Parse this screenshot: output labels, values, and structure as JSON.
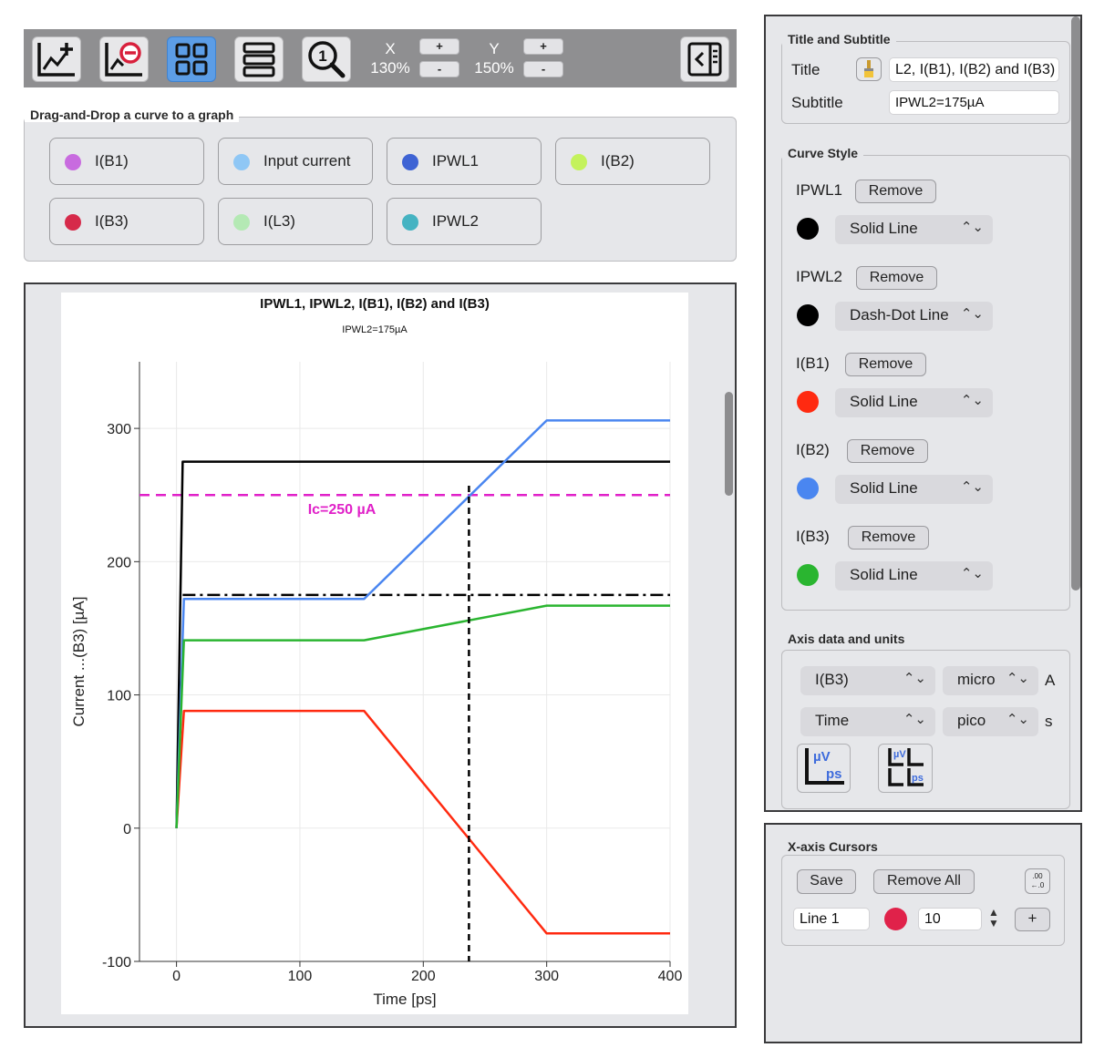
{
  "toolbar": {
    "icons": [
      "add-graph-icon",
      "remove-graph-icon",
      "grid-layout-icon",
      "list-layout-icon",
      "zoom-reset-icon",
      "sidebar-toggle-icon"
    ],
    "x_label": "X",
    "x_zoom": "130%",
    "y_label": "Y",
    "y_zoom": "150%",
    "plus": "+",
    "minus": "-"
  },
  "curves_group": {
    "title": "Drag-and-Drop a curve to a graph",
    "curves": [
      {
        "label": "I(B1)",
        "color": "#c86bdf"
      },
      {
        "label": "Input current",
        "color": "#8fc7f5"
      },
      {
        "label": "IPWL1",
        "color": "#3e63d4"
      },
      {
        "label": "I(B2)",
        "color": "#c4f25c"
      },
      {
        "label": "I(B3)",
        "color": "#d62a4a"
      },
      {
        "label": "I(L3)",
        "color": "#b4e9b4"
      },
      {
        "label": "IPWL2",
        "color": "#45b3c2"
      }
    ]
  },
  "chart_data": {
    "type": "line",
    "title": "IPWL1, IPWL2, I(B1), I(B2) and I(B3)",
    "subtitle": "IPWL2=175µA",
    "xlabel": "Time [ps]",
    "ylabel": "Current ...(B3) [µA]",
    "xlim": [
      -30,
      400
    ],
    "ylim": [
      -100,
      350
    ],
    "xticks": [
      0,
      100,
      200,
      300,
      400
    ],
    "yticks": [
      -100,
      0,
      100,
      200,
      300
    ],
    "grid": true,
    "series": [
      {
        "color": "#000000",
        "style": "solid",
        "x": [
          0,
          5,
          400
        ],
        "y": [
          0,
          275,
          275
        ]
      },
      {
        "color": "#000000",
        "style": "dashdot",
        "x": [
          5,
          400
        ],
        "y": [
          175,
          175
        ]
      },
      {
        "color": "#ff2a10",
        "style": "solid",
        "x": [
          0,
          6,
          152,
          300,
          400
        ],
        "y": [
          0,
          88,
          88,
          -79,
          -79
        ]
      },
      {
        "color": "#4a86f0",
        "style": "solid",
        "x": [
          0,
          6,
          152,
          300,
          400
        ],
        "y": [
          0,
          172,
          172,
          306,
          306
        ]
      },
      {
        "color": "#2ab530",
        "style": "solid",
        "x": [
          0,
          6,
          152,
          300,
          400
        ],
        "y": [
          0,
          141,
          141,
          167,
          167
        ]
      }
    ],
    "hline": {
      "y": 250,
      "color": "#e020c8",
      "style": "dashed",
      "label": "Ic=250 µA"
    },
    "cursor": {
      "x": 237,
      "color": "#000000",
      "style": "dashed"
    }
  },
  "title_group": {
    "title": "Title and Subtitle",
    "title_label": "Title",
    "title_value": "L2, I(B1), I(B2) and I(B3)",
    "subtitle_label": "Subtitle",
    "subtitle_value": "IPWL2=175µA",
    "brush_icon": "paintbrush-icon"
  },
  "curve_style": {
    "title": "Curve Style",
    "remove_label": "Remove",
    "items": [
      {
        "name": "IPWL1",
        "color": "#000000",
        "style": "Solid Line"
      },
      {
        "name": "IPWL2",
        "color": "#000000",
        "style": "Dash-Dot Line"
      },
      {
        "name": "I(B1)",
        "color": "#ff2a10",
        "style": "Solid Line"
      },
      {
        "name": "I(B2)",
        "color": "#4a86f0",
        "style": "Solid Line"
      },
      {
        "name": "I(B3)",
        "color": "#2ab530",
        "style": "Solid Line"
      }
    ]
  },
  "axis_group": {
    "title": "Axis data and units",
    "y_data": "I(B3)",
    "y_prefix": "micro",
    "y_unit": "A",
    "x_data": "Time",
    "x_prefix": "pico",
    "x_unit": "s",
    "unit_icon_1_top": "µV",
    "unit_icon_1_bottom": "ps",
    "unit_icon_2_top": "µV",
    "unit_icon_2_bottom": "ps"
  },
  "cursors": {
    "title": "X-axis Cursors",
    "save_label": "Save",
    "remove_all_label": "Remove All",
    "line_name": "Line 1",
    "line_color": "#e0224a",
    "line_width": "10",
    "add_label": "+",
    "decimal_icon_top": ".00",
    "decimal_icon_bottom": "←.0"
  }
}
